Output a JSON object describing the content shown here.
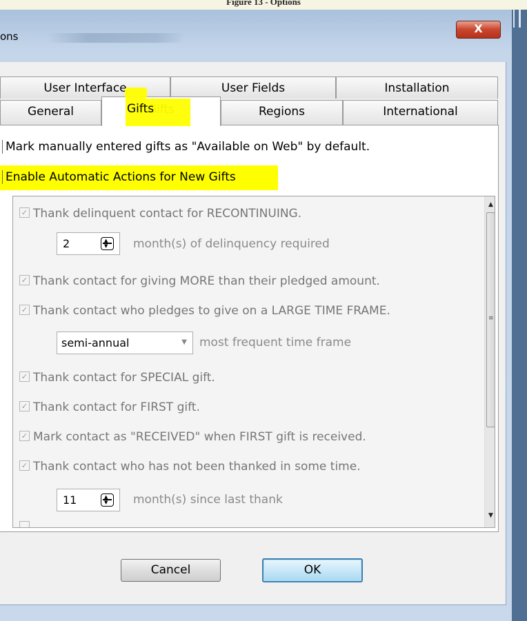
{
  "figure_caption": "Figure 13 - Options",
  "window": {
    "title_partial": "ons",
    "close_label": "X"
  },
  "tabs": {
    "row1": [
      "User Interface",
      "User Fields",
      "Installation"
    ],
    "row2": [
      "General",
      "Gifts",
      "Regions",
      "International"
    ],
    "active": "Gifts"
  },
  "options": {
    "mark_web": "Mark manually entered gifts as \"Available on Web\" by default.",
    "enable_auto": "Enable Automatic Actions for New Gifts"
  },
  "actions": {
    "recontinuing": "Thank delinquent contact for RECONTINUING.",
    "delinquency_value": "2",
    "delinquency_label": "month(s) of delinquency required",
    "more_than_pledged": "Thank contact for giving MORE than their pledged amount.",
    "large_time_frame": "Thank contact who pledges to give on a LARGE TIME FRAME.",
    "time_frame_value": "semi-annual",
    "time_frame_label": "most frequent time frame",
    "special_gift": "Thank contact for SPECIAL gift.",
    "first_gift": "Thank contact for FIRST gift.",
    "mark_received": "Mark contact as \"RECEIVED\" when FIRST gift is received.",
    "not_thanked": "Thank contact who has not been thanked in some time.",
    "months_value": "11",
    "months_label": "month(s) since last thank"
  },
  "buttons": {
    "cancel": "Cancel",
    "ok": "OK"
  },
  "colors": {
    "highlight": "#ffff00",
    "close_red": "#c9452d",
    "ok_border": "#3c7fb1"
  }
}
